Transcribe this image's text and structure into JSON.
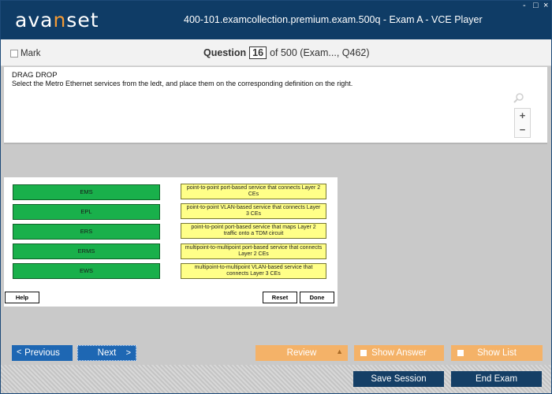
{
  "app": {
    "logo_pre": "ava",
    "logo_accent": "n",
    "logo_post": "set",
    "window_title": "400-101.examcollection.premium.exam.500q - Exam A - VCE Player",
    "minimize_glyph": "-",
    "maximize_glyph": "□",
    "close_glyph": "×"
  },
  "question_bar": {
    "mark_label": "Mark",
    "question_label": "Question",
    "question_number": "16",
    "of_text": "of 500 (Exam..., Q462)"
  },
  "question": {
    "type": "DRAG DROP",
    "text": "Select the Metro Ethernet services from the ledt, and place them on the corresponding definition on the right.",
    "zoom_in": "+",
    "zoom_out": "−"
  },
  "exhibit": {
    "services": [
      "EMS",
      "EPL",
      "ERS",
      "ERMS",
      "EWS"
    ],
    "definitions": [
      "point-to-point port-based service that connects Layer 2 CEs",
      "point-to-point VLAN-based service that connects Layer 3 CEs",
      "point-to-point port-based service that maps Layer 2 traffic onto a TDM circuit",
      "multipoint-to-multipoint port-based service that connects Layer 2 CEs",
      "multipoint-to-multipoint VLAN-based service that connects Layer 3 CEs"
    ],
    "help_label": "Help",
    "reset_label": "Reset",
    "done_label": "Done"
  },
  "nav": {
    "previous_label": "Previous",
    "next_label": "Next",
    "review_label": "Review",
    "show_answer_label": "Show Answer",
    "show_list_label": "Show List"
  },
  "footer": {
    "save_session_label": "Save Session",
    "end_exam_label": "End Exam"
  },
  "colors": {
    "title_bar": "#0f3c66",
    "logo_accent": "#f29a36",
    "nav_blue": "#1e67b3",
    "nav_orange": "#f4b268",
    "service_green": "#19b04b",
    "definition_yellow": "#ffff88",
    "footer_button": "#153f66"
  }
}
